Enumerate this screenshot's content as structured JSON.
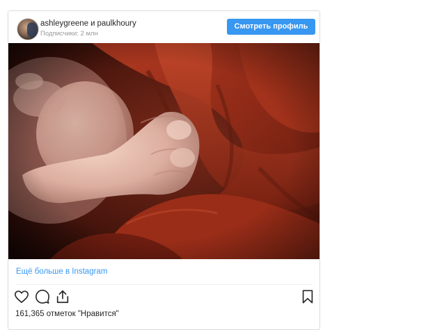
{
  "header": {
    "user1": "ashleygreene",
    "separator": "и",
    "user2": "paulkhoury",
    "followers": "Подписчики: 2 млн",
    "view_profile_label": "Смотреть профиль"
  },
  "post": {
    "more_link": "Ещё больше в Instagram",
    "likes": "161,365 отметок \"Нравится\""
  },
  "icons": {
    "like": "heart-icon",
    "comment": "comment-icon",
    "share": "share-icon",
    "save": "bookmark-icon"
  },
  "colors": {
    "accent": "#3897f0",
    "text": "#262626",
    "muted": "#999999",
    "border": "#dbdbdb"
  }
}
